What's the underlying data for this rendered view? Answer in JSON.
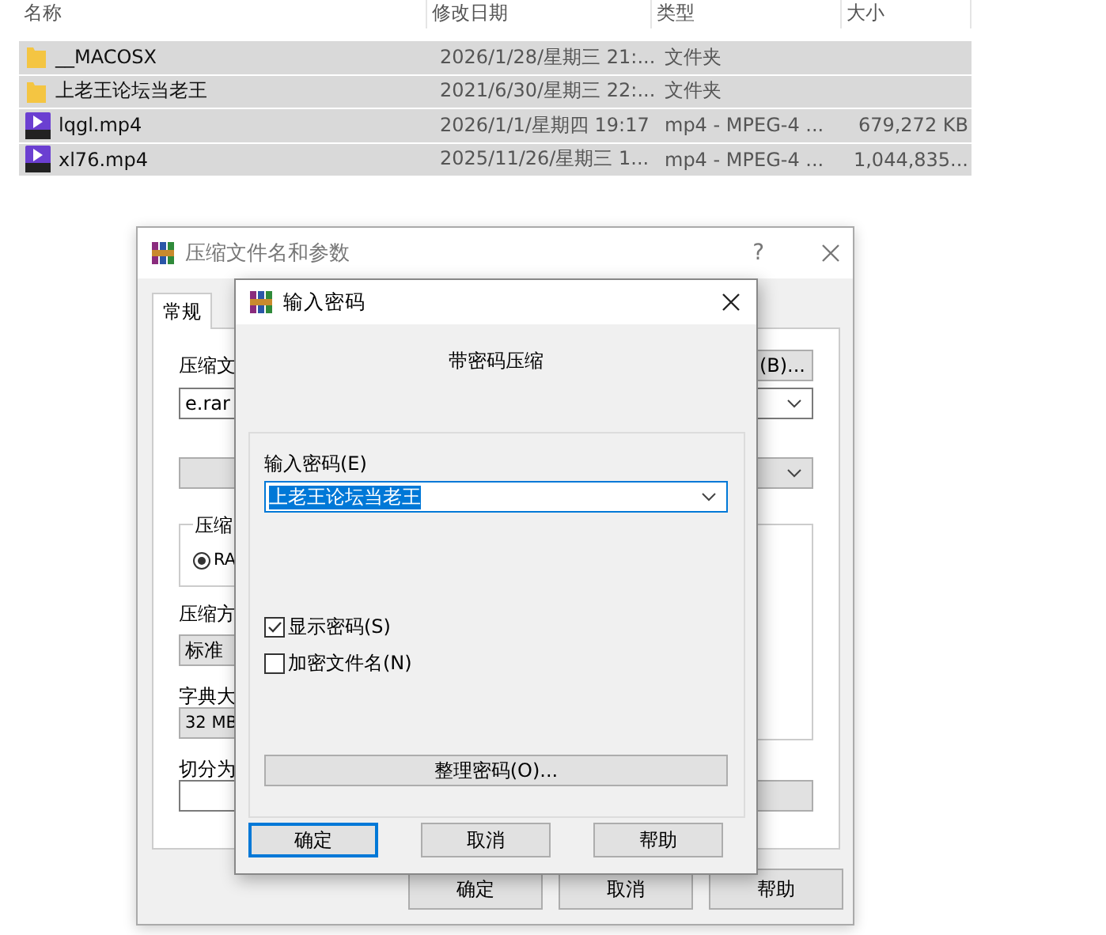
{
  "file_list": {
    "columns": [
      "名称",
      "修改日期",
      "类型",
      "大小"
    ],
    "rows": [
      {
        "kind": "folder",
        "name": "__MACOSX",
        "modified": "2026/1/28/星期三 21:...",
        "type": "文件夹",
        "selected": true
      },
      {
        "kind": "folder",
        "name": "上老王论坛当老王",
        "modified": "2021/6/30/星期三 22:...",
        "type": "文件夹",
        "selected": true
      },
      {
        "kind": "video",
        "name": "lqgl.mp4",
        "modified": "2026/1/1/星期四 19:17",
        "type": "mp4 - MPEG-4 ...",
        "size": "679,272 KB",
        "selected": true
      },
      {
        "kind": "video",
        "name": "xl76.mp4",
        "modified": "2025/11/26/星期三 1...",
        "type": "mp4 - MPEG-4 ...",
        "size": "1,044,835...",
        "selected": true
      }
    ]
  },
  "archive_dialog": {
    "title": "压缩文件名和参数",
    "help": "?",
    "tabs": [
      {
        "label": "常规",
        "selected": true
      }
    ],
    "name_label": "压缩文",
    "browse_button": "(B)...",
    "name_value": "e.rar",
    "group_label": "压缩",
    "format_option": {
      "label": "RA",
      "selected": true
    },
    "method_label": "压缩方",
    "method_value": "标准",
    "dict_label": "字典大",
    "dict_value": "32 MB",
    "split_label": "切分为",
    "buttons": [
      "确定",
      "取消",
      "帮助"
    ]
  },
  "password_dialog": {
    "title": "输入密码",
    "heading": "带密码压缩",
    "password_label": "输入密码(E)",
    "password_value": "上老王论坛当老王",
    "value_selected": true,
    "options": [
      {
        "label": "显示密码(S)",
        "checked": true
      },
      {
        "label": "加密文件名(N)",
        "checked": false
      }
    ],
    "organize_button": "整理密码(O)...",
    "buttons": [
      {
        "label": "确定",
        "default": true
      },
      {
        "label": "取消",
        "default": false
      },
      {
        "label": "帮助",
        "default": false
      }
    ]
  }
}
